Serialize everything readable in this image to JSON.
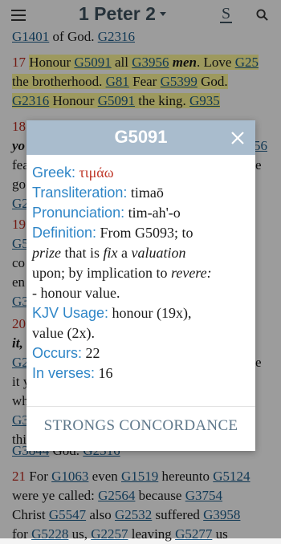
{
  "header": {
    "title": "1 Peter 2",
    "strongs_toggle": "S"
  },
  "bible": {
    "l1": {
      "a": "G1401",
      "b": " of God. ",
      "c": "G2316"
    },
    "v17": {
      "num": "17",
      "l1": [
        "Honour ",
        "G5091",
        " all ",
        "G3956",
        "men",
        ". Love ",
        "G25"
      ],
      "l2": [
        "the brotherhood. ",
        "G81",
        " Fear ",
        "G5399",
        " God."
      ],
      "l3": [
        "G2316",
        " Honour ",
        "G5091",
        " the king. ",
        "G935"
      ]
    },
    "v18": {
      "num": "18",
      "side_l1": "yo",
      "side_r1": "56",
      "side_l2": "fea",
      "side_r2": "e",
      "side_l3": "go",
      "side_l4": "G2"
    },
    "v19": {
      "num": "19",
      "side_l1": "G5",
      "side_l2": "co",
      "side_l3": "en",
      "side_l4": "G3"
    },
    "v20": {
      "num": "20",
      "side_l1": "it,",
      "side_l2": "G2",
      "side_r2": "e",
      "side_l3": "it y",
      "side_l4": "wh",
      "side_l5": "G3",
      "side_l6": "thi"
    },
    "l_end20": [
      "G3844",
      " God. ",
      "G2316"
    ],
    "v21": {
      "num": "21",
      "l1": [
        " For ",
        "G1063",
        " even ",
        "G1519",
        " hereunto ",
        "G5124"
      ],
      "l2": [
        "were ye called: ",
        "G2564",
        " because ",
        "G3754"
      ],
      "l3": [
        "Christ ",
        "G5547",
        " also ",
        "G2532",
        " suffered ",
        "G3958"
      ],
      "l4": [
        "for ",
        "G5228",
        " us, ",
        "G2257",
        " leaving ",
        "G5277",
        " us"
      ]
    }
  },
  "dialog": {
    "title": "G5091",
    "greek_label": "Greek:",
    "greek_value": "τιμάω",
    "translit_label": "Transliteration:",
    "translit_value": "timaō",
    "pron_label": "Pronunciation:",
    "pron_value": "tim-ah'-o",
    "def_label": "Definition:",
    "def_1": " From G5093; to",
    "def_2a": "prize",
    "def_2b": " that is ",
    "def_2c": "fix",
    "def_2d": " a ",
    "def_2e": "valuation",
    "def_3a": "upon; by implication to ",
    "def_3b": "revere:",
    "def_4": "- honour value.",
    "kjv_label": "KJV Usage:",
    "kjv_1": " honour (19x),",
    "kjv_2": "value (2x).",
    "occurs_label": "Occurs:",
    "occurs_value": " 22",
    "verses_label": "In verses:",
    "verses_value": " 16",
    "footer": "STRONGS CONCORDANCE"
  }
}
